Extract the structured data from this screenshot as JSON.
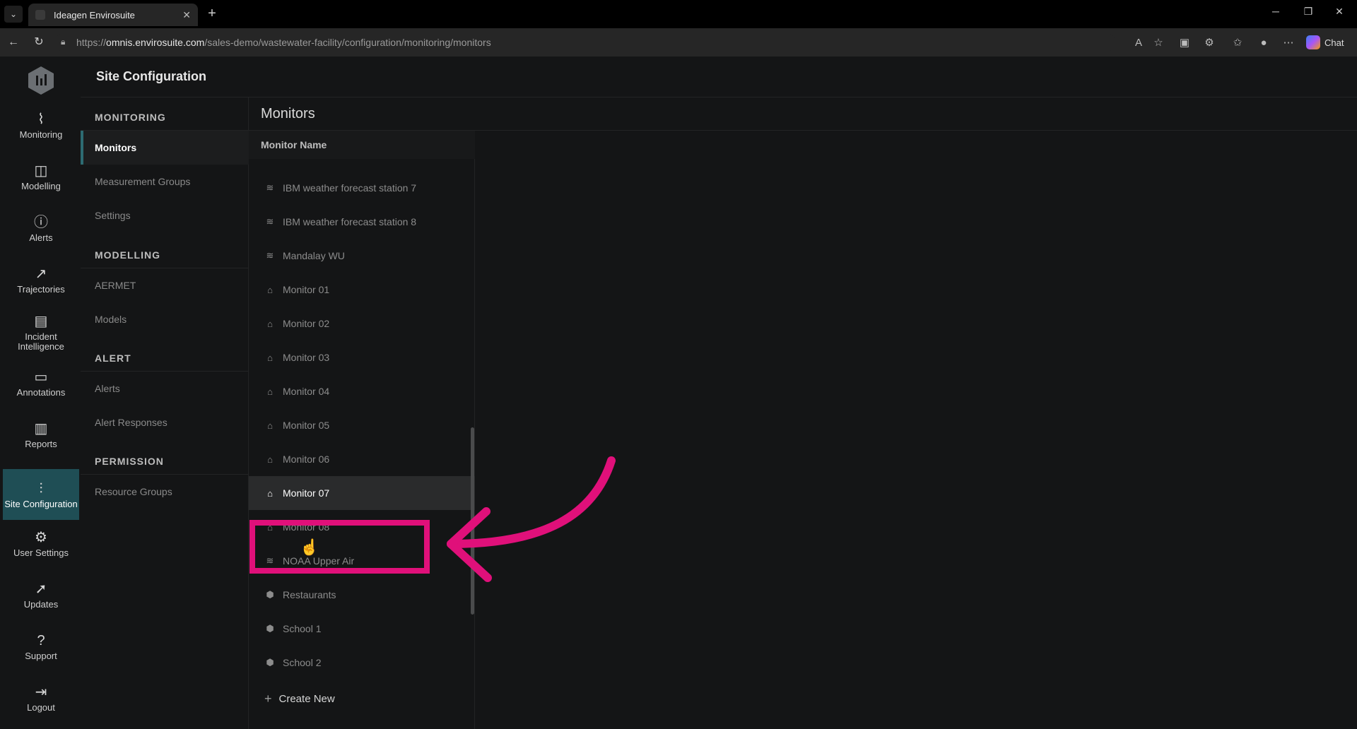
{
  "browser": {
    "tab_title": "Ideagen Envirosuite",
    "url_prefix": "https://",
    "url_host": "omnis.envirosuite.com",
    "url_path": "/sales-demo/wastewater-facility/configuration/monitoring/monitors",
    "chat_label": "Chat"
  },
  "rail": {
    "items": [
      {
        "label": "Monitoring",
        "icon": "pulse-icon"
      },
      {
        "label": "Modelling",
        "icon": "modelling-icon"
      },
      {
        "label": "Alerts",
        "icon": "alert-icon"
      },
      {
        "label": "Trajectories",
        "icon": "trajectory-icon"
      },
      {
        "label": "Incident Intelligence",
        "icon": "incident-icon"
      },
      {
        "label": "Annotations",
        "icon": "annotation-icon"
      },
      {
        "label": "Reports",
        "icon": "reports-icon"
      },
      {
        "label": "Site Configuration",
        "icon": "sliders-icon"
      },
      {
        "label": "User Settings",
        "icon": "gear-icon"
      },
      {
        "label": "Updates",
        "icon": "rocket-icon"
      },
      {
        "label": "Support",
        "icon": "help-icon"
      },
      {
        "label": "Logout",
        "icon": "logout-icon"
      }
    ]
  },
  "header": {
    "title": "Site Configuration"
  },
  "subnav": {
    "monitoring_title": "MONITORING",
    "monitors": "Monitors",
    "measurement_groups": "Measurement Groups",
    "settings": "Settings",
    "modelling_title": "MODELLING",
    "aermet": "AERMET",
    "models": "Models",
    "alert_title": "ALERT",
    "alerts": "Alerts",
    "alert_responses": "Alert Responses",
    "permission_title": "PERMISSION",
    "resource_groups": "Resource Groups"
  },
  "main": {
    "title": "Monitors",
    "column_header": "Monitor Name",
    "rows": [
      {
        "name": "IBM weather forecast station 7",
        "icon": "weather-icon"
      },
      {
        "name": "IBM weather forecast station 8",
        "icon": "weather-icon"
      },
      {
        "name": "Mandalay WU",
        "icon": "weather-icon"
      },
      {
        "name": "Monitor 01",
        "icon": "sensor-icon"
      },
      {
        "name": "Monitor 02",
        "icon": "sensor-icon"
      },
      {
        "name": "Monitor 03",
        "icon": "sensor-icon"
      },
      {
        "name": "Monitor 04",
        "icon": "sensor-icon"
      },
      {
        "name": "Monitor 05",
        "icon": "sensor-icon"
      },
      {
        "name": "Monitor 06",
        "icon": "sensor-icon"
      },
      {
        "name": "Monitor 07",
        "icon": "sensor-icon"
      },
      {
        "name": "Monitor 08",
        "icon": "sensor-icon"
      },
      {
        "name": "NOAA Upper Air",
        "icon": "weather-icon"
      },
      {
        "name": "Restaurants",
        "icon": "receptor-icon"
      },
      {
        "name": "School 1",
        "icon": "receptor-icon"
      },
      {
        "name": "School 2",
        "icon": "receptor-icon"
      }
    ],
    "create_new": "Create New"
  },
  "colors": {
    "accent": "#1f4e55",
    "highlight": "#e0107a"
  }
}
